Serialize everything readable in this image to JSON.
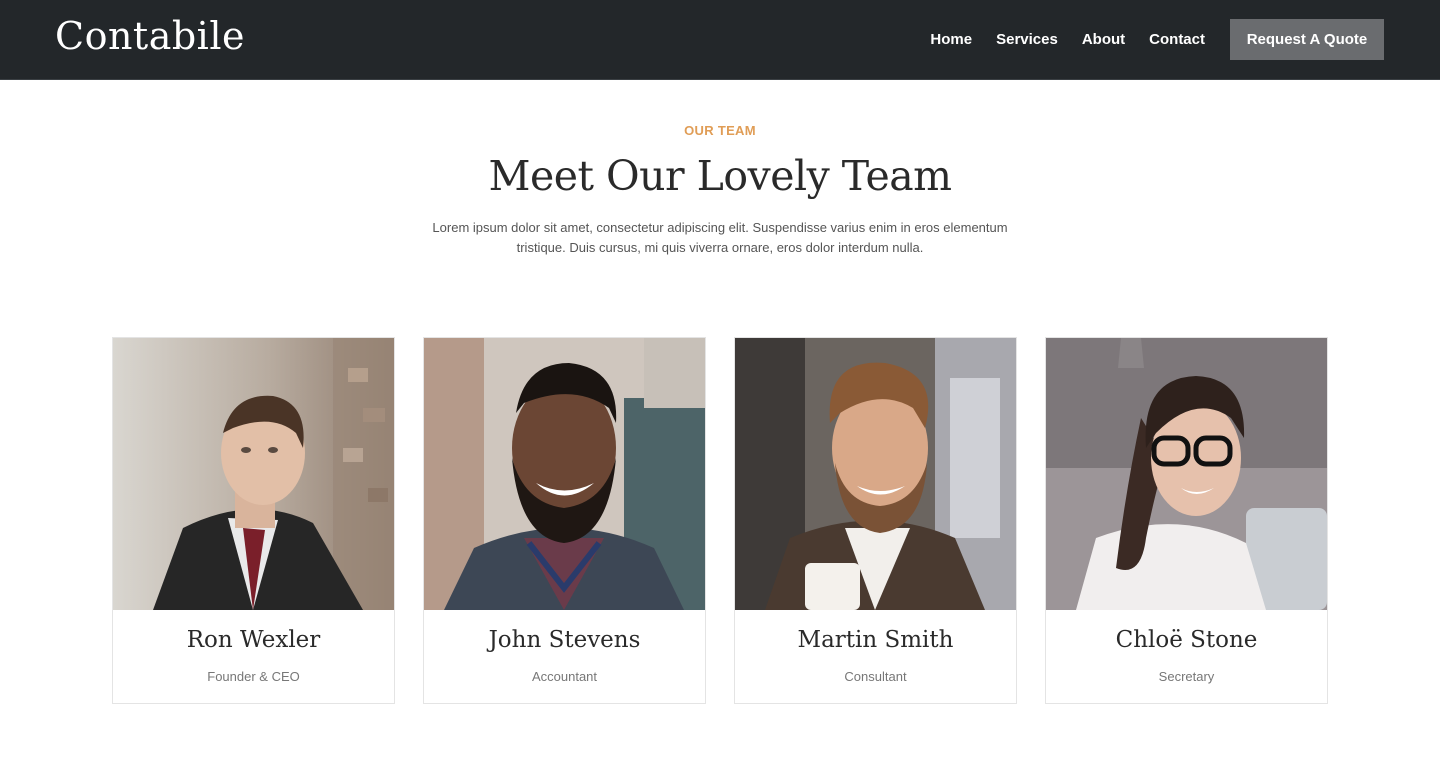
{
  "header": {
    "logo": "Contabile",
    "nav": [
      {
        "label": "Home"
      },
      {
        "label": "Services"
      },
      {
        "label": "About"
      },
      {
        "label": "Contact"
      }
    ],
    "cta_label": "Request A Quote"
  },
  "intro": {
    "eyebrow": "OUR TEAM",
    "title": "Meet Our Lovely Team",
    "description": "Lorem ipsum dolor sit amet, consectetur adipiscing elit. Suspendisse varius enim in eros elementum tristique. Duis cursus, mi quis viverra ornare, eros dolor interdum nulla."
  },
  "team": [
    {
      "name": "Ron Wexler",
      "role": "Founder & CEO"
    },
    {
      "name": "John Stevens",
      "role": "Accountant"
    },
    {
      "name": "Martin Smith",
      "role": "Consultant"
    },
    {
      "name": "Chloë Stone",
      "role": "Secretary"
    }
  ],
  "colors": {
    "header_bg": "#23272a",
    "accent": "#e09d56",
    "button_bg": "#6a6c6f"
  }
}
